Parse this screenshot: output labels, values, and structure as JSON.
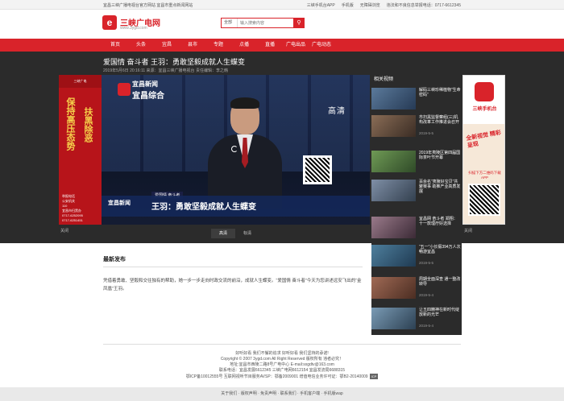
{
  "topbar": {
    "left_text": "宜昌三峡广播电视台官方网站 宜昌市重点新闻网站",
    "links": [
      "三峡手机台APP",
      "手机版",
      "无障碍浏览",
      "违法和不良信息举报电话：0717-6612345"
    ]
  },
  "logo": {
    "mark": "e",
    "name": "三峡广电网",
    "url": "www.3ygd.com"
  },
  "search": {
    "select": "全部",
    "placeholder": "输入搜索内容",
    "button_icon": "search-icon"
  },
  "nav": [
    "首页",
    "头条",
    "宜昌",
    "县市",
    "专题",
    "点播",
    "直播",
    "广电出品",
    "广电动态"
  ],
  "article": {
    "title": "爱国情 奋斗者 王羽：勇敢坚毅成就人生蝶变",
    "meta": "2019年5月6日 20:16:11  来源：宜昌三峡广播电视台    责任编辑：李之韩"
  },
  "ad_left": {
    "header": "三峡广电",
    "text1": "保持高压态势",
    "text2": "扶黑除恶",
    "caption": "举报电话\n公安机关\n110\n宜昌市扫黑办\n0717-6252095\n0717-6251451",
    "label": "关闭"
  },
  "video": {
    "channel_line1": "宜昌新闻",
    "channel_line2": "宜昌综合",
    "hd": "高清",
    "band_logo": "宜昌新闻",
    "band_sub": "YICHANG NEWS",
    "tag": "爱国情 奋斗者",
    "caption": "王羽：勇敢坚毅成就人生蝶变"
  },
  "tabs": [
    "高清",
    "标清"
  ],
  "related": {
    "heading": "相关视频",
    "items": [
      {
        "title": "解码三峡珍稀植物“生命密码”",
        "date": "2019-5-6"
      },
      {
        "title": "市扫黑监督察组(三)机构改革工作推进会召开",
        "date": "2019-5-5"
      },
      {
        "title": "2019年夷陵区第四届国际茶叶节开幕",
        "date": "2019-5-5"
      },
      {
        "title": "百余名“夷陵好宝贝”共聚赛事 助推产业高质发展",
        "date": "2019-5-5"
      },
      {
        "title": "宜昌网 奋斗者 郑翔：十一款理疗好选择",
        "date": "2019-5-5"
      }
    ]
  },
  "ad_right": {
    "name": "三峡手机台",
    "slogan": "全新视觉 精彩呈现",
    "download": "扫描下方二维码下载APP",
    "label": "关闭"
  },
  "latest": {
    "heading": "最新发布",
    "paragraph": "凭借着勇敢、坚毅和交往独有的帮助，她一步一步走向时政交流的前沿，成就人生蝶变。“爱国情 奋斗者”今天为您讲述远安飞出的“金凤凰”王羽。"
  },
  "side_news": [
    {
      "title": "“五一”小长假394万人次畅游宜昌",
      "date": "2019-5-5"
    },
    {
      "title": "周期全面深查 通一整改转导",
      "date": "2019-5-4"
    },
    {
      "title": "让五四精神在新时代绽放新的光芒",
      "date": "2019-5-4"
    }
  ],
  "footer": {
    "line1": "好听好看 我们不懈的追求 好听好看 我们坚持的承诺!",
    "line2": "Copyright © 2007 3ygd.com All Right Reserved 版权所有 违者必究！",
    "line3": "地址:宜昌市西陵二路8号广电中心 E-mail:sxgdtv@163.com",
    "line4": "联系电话：宜昌发展6612345 三峡广电网6612154 宜昌发流局6688315",
    "line5": "鄂ICP备10012555号 互联网视听节目服务AVSP：鄂备2009001 增值电信业务许可证：鄂B2-20140009",
    "badge": "ICP",
    "bottom": "关于我们 · 版权声明 · 免责声明 · 联系我们 · 手机客户端 · 手机版wap"
  }
}
